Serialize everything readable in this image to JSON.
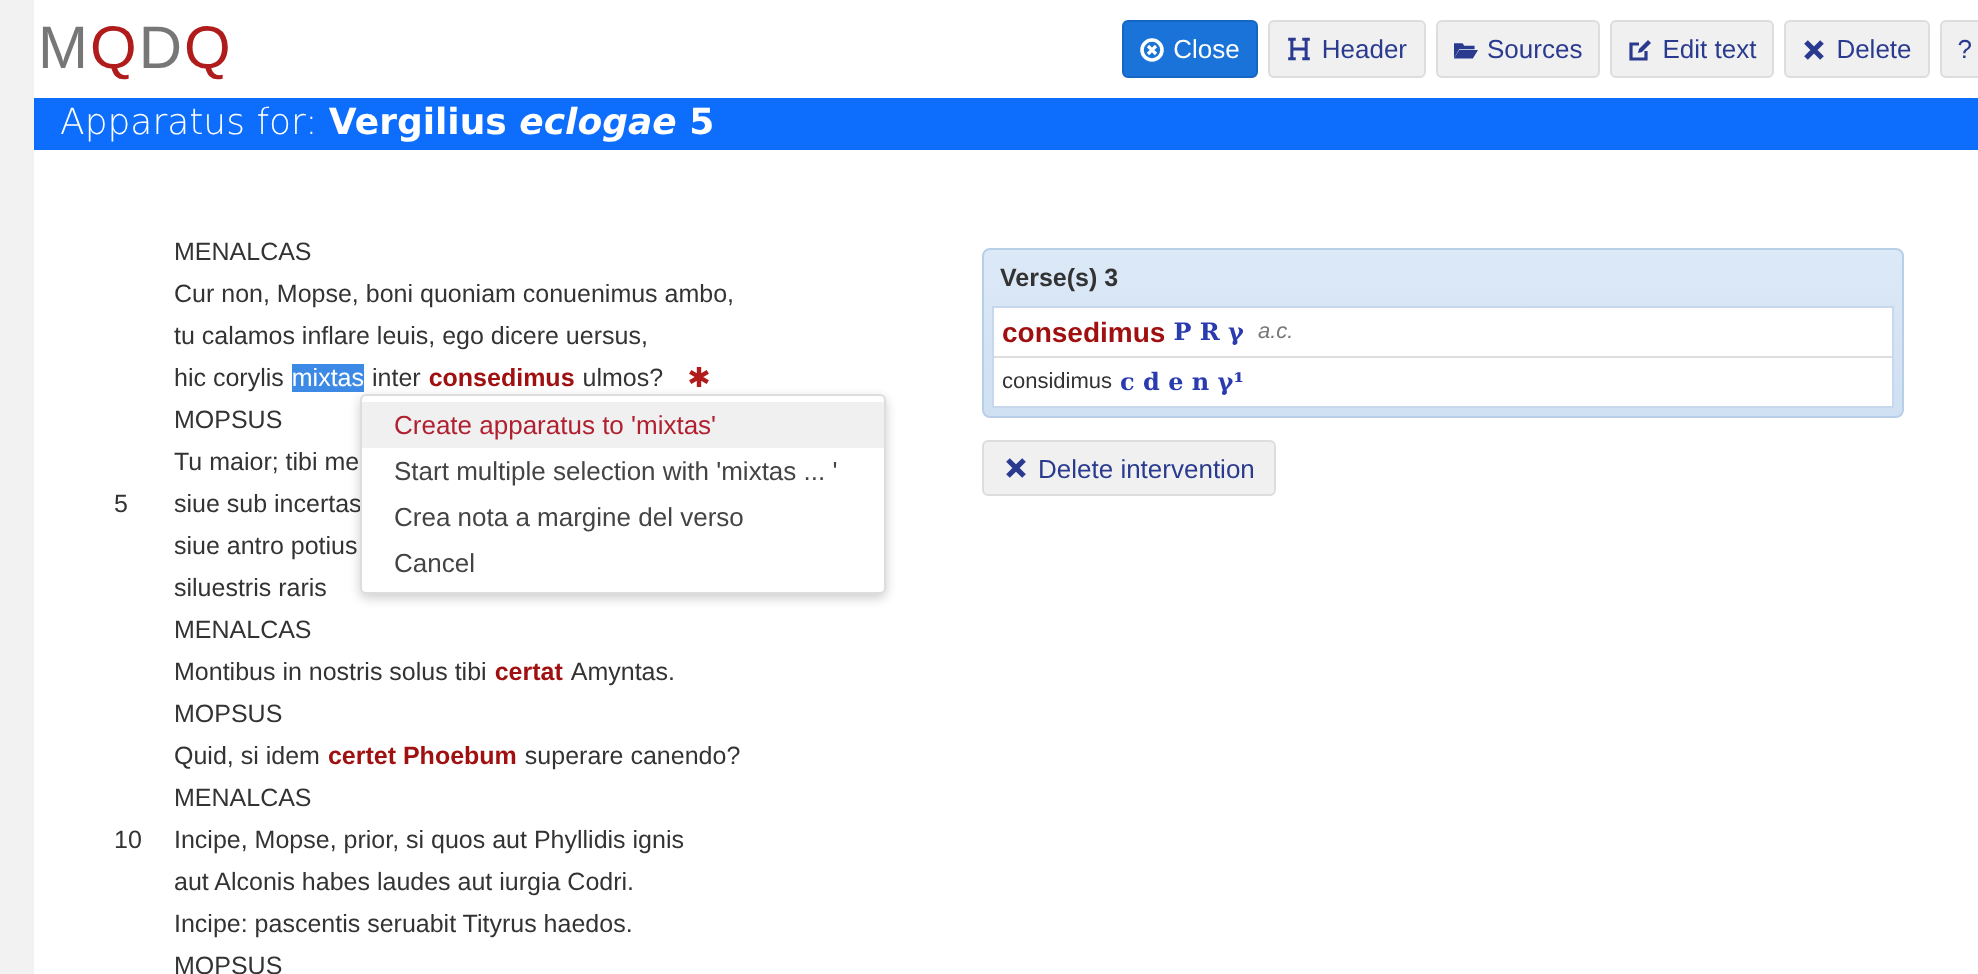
{
  "logo": [
    {
      "text": "M",
      "color": "#777777"
    },
    {
      "text": "Q",
      "color": "#b01c1c"
    },
    {
      "text": "D",
      "color": "#777777"
    },
    {
      "text": "Q",
      "color": "#b01c1c"
    }
  ],
  "toolbar": [
    {
      "label": "Close",
      "kind": "close"
    },
    {
      "label": "Header",
      "kind": "header"
    },
    {
      "label": "Sources",
      "kind": "sources"
    },
    {
      "label": "Edit text",
      "kind": "edit"
    },
    {
      "label": "Delete",
      "kind": "delete"
    },
    {
      "label": "?",
      "kind": "help"
    }
  ],
  "title_bar": {
    "text": "Apparatus for: **Vergilius *eclogae* 5**"
  },
  "text_lines": [
    {
      "segments": [
        {
          "text": "MENALCAS",
          "kind": "plain"
        }
      ]
    },
    {
      "segments": [
        {
          "text": "Cur non, Mopse, boni quoniam conuenimus ambo,",
          "kind": "plain"
        }
      ]
    },
    {
      "segments": [
        {
          "text": "tu calamos inflare leuis, ego dicere uersus,",
          "kind": "plain"
        }
      ]
    },
    {
      "segments": [
        {
          "text": "hic corylis",
          "kind": "plain"
        },
        {
          "text": "mixtas",
          "kind": "selected"
        },
        {
          "text": "inter",
          "kind": "plain"
        },
        {
          "text": "consedimus",
          "kind": "variant"
        },
        {
          "text": "ulmos?",
          "kind": "plain"
        }
      ],
      "marked": true
    },
    {
      "segments": [
        {
          "text": "MOPSUS",
          "kind": "plain"
        }
      ]
    },
    {
      "segments": [
        {
          "text": "Tu maior; tibi me",
          "kind": "plain"
        }
      ]
    },
    {
      "number": "5",
      "segments": [
        {
          "text": "siue sub incertas",
          "kind": "plain"
        }
      ]
    },
    {
      "segments": [
        {
          "text": "siue antro potius",
          "kind": "plain"
        }
      ]
    },
    {
      "segments": [
        {
          "text": "siluestris raris",
          "kind": "plain"
        }
      ]
    },
    {
      "segments": [
        {
          "text": "MENALCAS",
          "kind": "plain"
        }
      ]
    },
    {
      "segments": [
        {
          "text": "Montibus in nostris solus tibi",
          "kind": "plain"
        },
        {
          "text": "certat",
          "kind": "variant"
        },
        {
          "text": "Amyntas.",
          "kind": "plain"
        }
      ]
    },
    {
      "segments": [
        {
          "text": "MOPSUS",
          "kind": "plain"
        }
      ]
    },
    {
      "segments": [
        {
          "text": "Quid, si idem",
          "kind": "plain"
        },
        {
          "text": "certet Phoebum",
          "kind": "variant"
        },
        {
          "text": "superare canendo?",
          "kind": "plain"
        }
      ]
    },
    {
      "segments": [
        {
          "text": "MENALCAS",
          "kind": "plain"
        }
      ]
    },
    {
      "number": "10",
      "segments": [
        {
          "text": "Incipe, Mopse, prior, si quos aut Phyllidis ignis",
          "kind": "plain"
        }
      ]
    },
    {
      "segments": [
        {
          "text": "aut Alconis habes laudes aut iurgia Codri.",
          "kind": "plain"
        }
      ]
    },
    {
      "segments": [
        {
          "text": "Incipe: pascentis seruabit Tityrus haedos.",
          "kind": "plain"
        }
      ]
    },
    {
      "segments": [
        {
          "text": "MOPSUS",
          "kind": "plain"
        }
      ]
    }
  ],
  "context_menu": [
    {
      "label": "Create apparatus to 'mixtas'",
      "selected": true
    },
    {
      "label": "Start multiple selection with 'mixtas ... '",
      "selected": false
    },
    {
      "label": "Crea nota a margine del verso",
      "selected": false
    },
    {
      "label": "Cancel",
      "selected": false
    }
  ],
  "apparatus_panel": {
    "heading": "Verse(s) 3",
    "entries": [
      {
        "reading": "consedimus",
        "lemma": true,
        "sigla": "P R γ",
        "note": "a.c."
      },
      {
        "reading": "considimus",
        "lemma": false,
        "sigla": "c d e n γ¹"
      }
    ]
  },
  "delete_button": {
    "label": "Delete intervention"
  }
}
